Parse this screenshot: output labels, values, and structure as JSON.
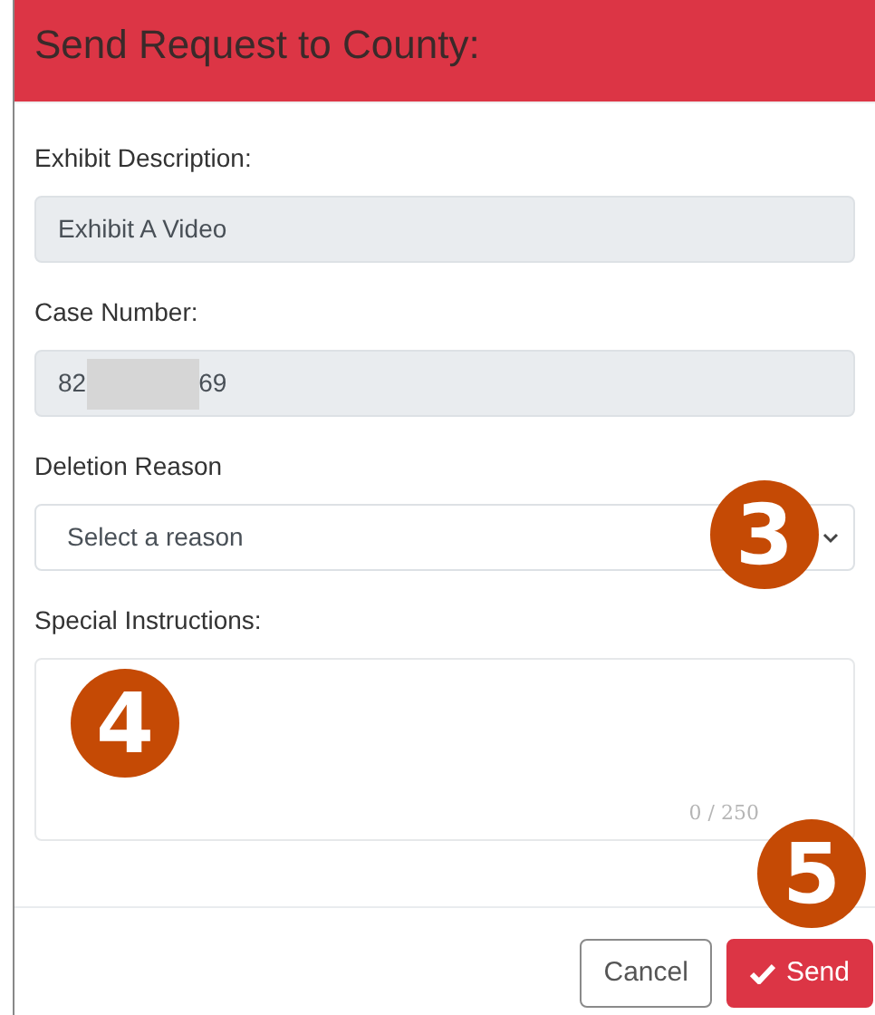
{
  "dialog": {
    "title": "Send Request to County:"
  },
  "fields": [
    {
      "kind": "readonly",
      "label": "Exhibit Description:",
      "value": "Exhibit A Video"
    },
    {
      "kind": "redacted",
      "label": "Case Number:",
      "value_start": "82",
      "value_end": "69"
    },
    {
      "kind": "select",
      "label": "Deletion Reason",
      "placeholder": "Select a reason"
    },
    {
      "kind": "textarea",
      "label": "Special Instructions:",
      "counter": "0 / 250"
    }
  ],
  "callouts": [
    "3",
    "4",
    "5"
  ],
  "buttons": [
    {
      "kind": "secondary",
      "label": "Cancel"
    },
    {
      "kind": "primary",
      "label": "Send"
    }
  ]
}
